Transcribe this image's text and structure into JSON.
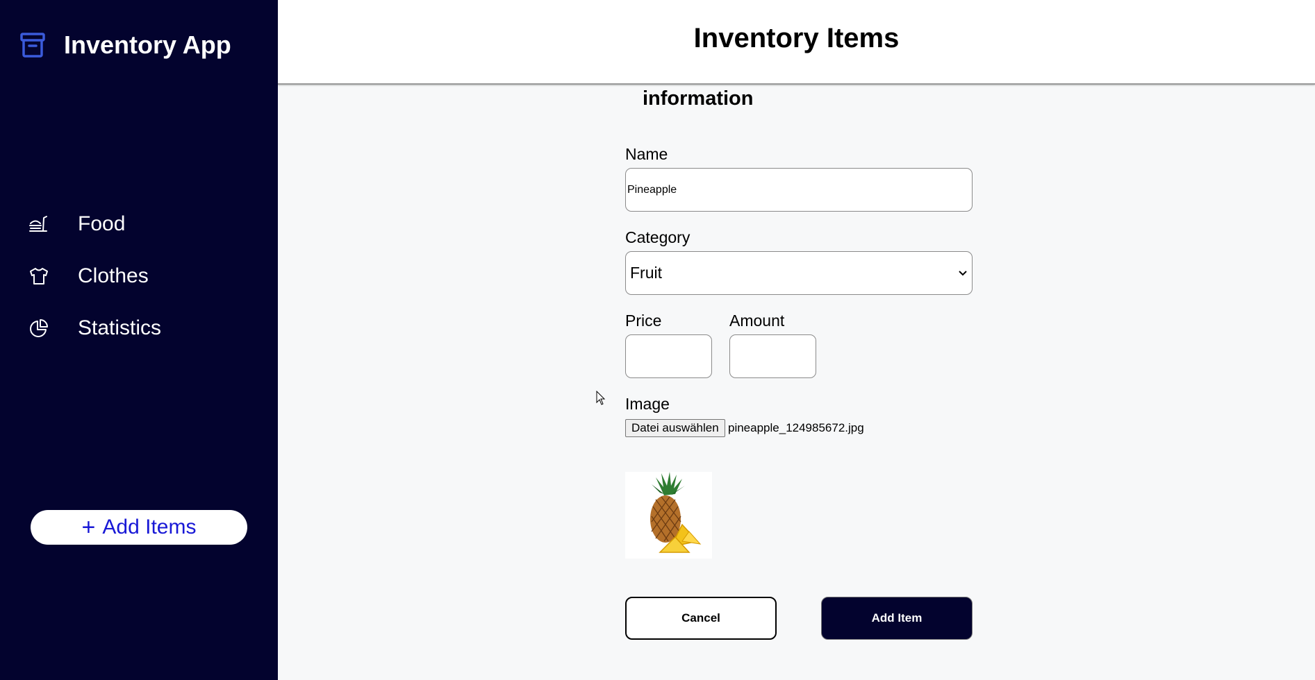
{
  "sidebar": {
    "brand": {
      "title": "Inventory App",
      "icon": "archive-box-icon"
    },
    "nav": [
      {
        "label": "Food",
        "icon": "food-icon"
      },
      {
        "label": "Clothes",
        "icon": "shirt-icon"
      },
      {
        "label": "Statistics",
        "icon": "pie-chart-icon"
      }
    ],
    "add_button": {
      "plus": "+",
      "label": "Add Items"
    }
  },
  "header": {
    "title": "Inventory Items"
  },
  "form": {
    "section_title": "information",
    "name": {
      "label": "Name",
      "value": "Pineapple"
    },
    "category": {
      "label": "Category",
      "value": "Fruit"
    },
    "price": {
      "label": "Price",
      "value": ""
    },
    "amount": {
      "label": "Amount",
      "value": ""
    },
    "image": {
      "label": "Image",
      "button_label": "Datei auswählen",
      "file_name": "pineapple_124985672.jpg"
    },
    "cancel_label": "Cancel",
    "submit_label": "Add Item"
  },
  "colors": {
    "sidebar_bg": "#03032e",
    "brand_icon": "#3b5bdb",
    "add_items_text": "#1818d6",
    "page_bg": "#f7f8f9"
  }
}
